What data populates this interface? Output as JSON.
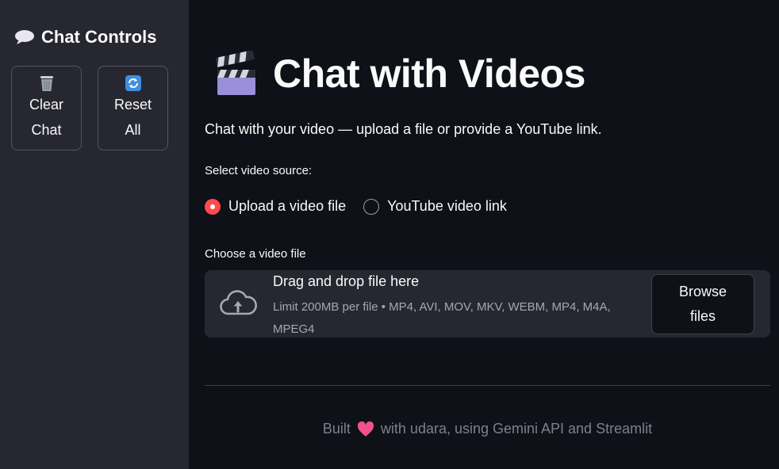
{
  "sidebar": {
    "header": "Chat Controls",
    "header_icon": "speech-bubble-icon",
    "buttons": [
      {
        "label": "Clear Chat",
        "icon": "wastebasket-icon"
      },
      {
        "label": "Reset All",
        "icon": "refresh-icon"
      }
    ]
  },
  "main": {
    "title": "Chat with Videos",
    "title_icon": "clapper-board-icon",
    "subtitle": "Chat with your video — upload a file or provide a YouTube link.",
    "source": {
      "label": "Select video source:",
      "options": [
        {
          "label": "Upload a video file",
          "selected": true
        },
        {
          "label": "YouTube video link",
          "selected": false
        }
      ]
    },
    "uploader": {
      "label": "Choose a video file",
      "drop_text": "Drag and drop file here",
      "limit_text": "Limit 200MB per file • MP4, AVI, MOV, MKV, WEBM, MP4, M4A, MPEG4",
      "browse_label": "Browse files"
    },
    "footer": {
      "before": "Built",
      "after": "with udara, using Gemini API and Streamlit",
      "icon": "heart-icon"
    }
  },
  "colors": {
    "background": "#0e1117",
    "sidebar": "#262730",
    "accent": "#ff4b4b",
    "text": "#fafafa",
    "muted": "#7d808a"
  }
}
